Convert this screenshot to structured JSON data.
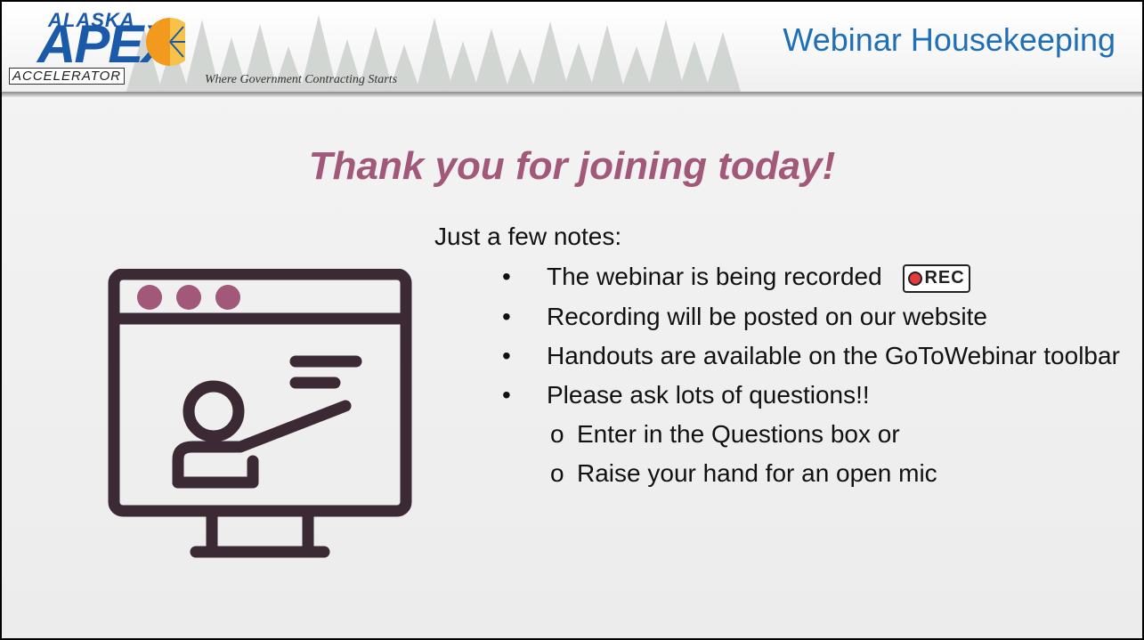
{
  "header": {
    "logo_alaska": "ALASKA",
    "logo_apex": "APEX",
    "logo_accelerator": "ACCELERATOR",
    "tagline": "Where Government Contracting Starts",
    "title": "Webinar Housekeeping"
  },
  "main": {
    "headline": "Thank you for joining today!",
    "intro": "Just a few notes:",
    "bullets": [
      "The webinar is being recorded",
      "Recording will be posted on our website",
      "Handouts are available on the GoToWebinar toolbar",
      "Please ask lots of questions!!"
    ],
    "sub_bullets": [
      "Enter in the Questions box or",
      "Raise your hand for an open mic"
    ],
    "rec_badge": "REC",
    "bullet_glyph": "•",
    "sub_bullet_glyph": "o"
  },
  "colors": {
    "header_title": "#1f6fb6",
    "headline": "#a25979",
    "icon_stroke": "#3b2a33",
    "icon_dots": "#a25979",
    "rec_dot": "#e23b3b"
  },
  "icons": {
    "presenter": "presenter-at-screen-icon",
    "record": "record-icon",
    "logo_sun": "sun-icon"
  }
}
